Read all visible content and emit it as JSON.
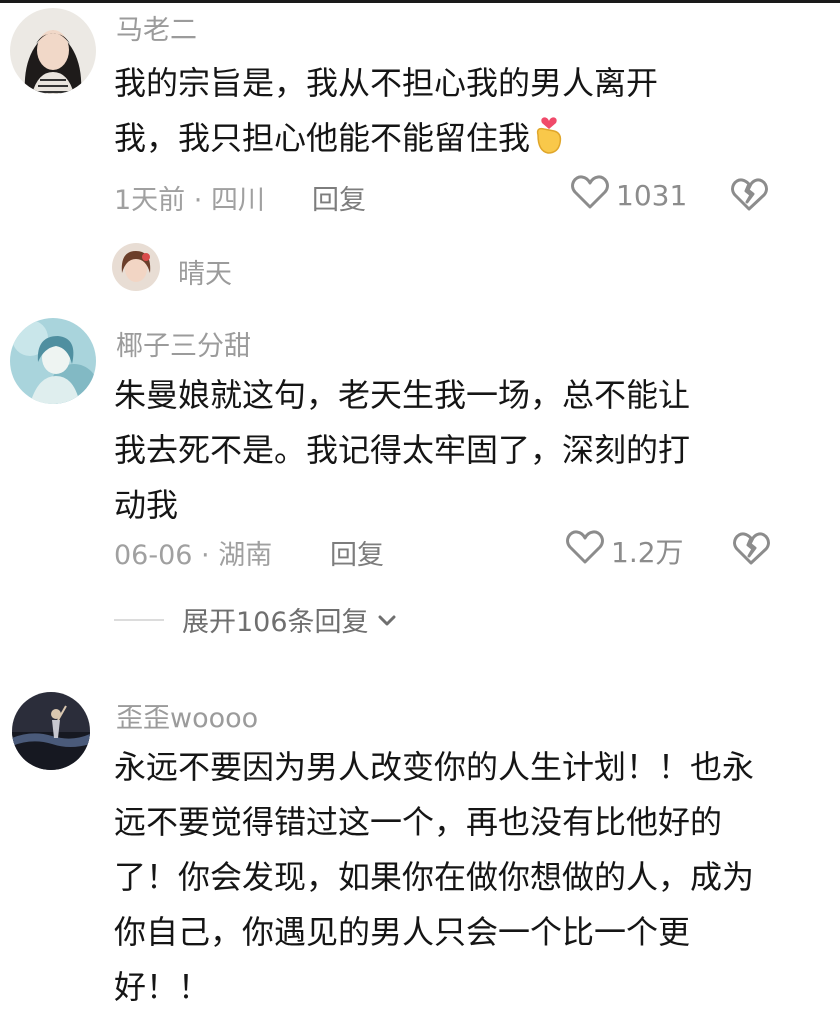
{
  "comments": [
    {
      "username": "马老二",
      "lines": [
        "我的宗旨是，我从不担心我的男人离开",
        "我，我只担心他能不能留住我"
      ],
      "emoji": "finger-heart-emoji",
      "date": "1天前",
      "location": "四川",
      "reply_label": "回复",
      "likes": "1031"
    },
    {
      "username": "椰子三分甜",
      "lines": [
        "朱曼娘就这句，老天生我一场，总不能让",
        "我去死不是。我记得太牢固了，深刻的打",
        "动我"
      ],
      "date": "06-06",
      "location": "湖南",
      "reply_label": "回复",
      "likes": "1.2万",
      "expand_label": "展开106条回复"
    },
    {
      "username": "歪歪woooo",
      "lines": [
        "永远不要因为男人改变你的人生计划！！也永",
        "远不要觉得错过这一个，再也没有比他好的",
        "了！你会发现，如果你在做你想做的人，成为",
        "你自己，你遇见的男人只会一个比一个更",
        "好！！"
      ]
    }
  ],
  "reply_thread": {
    "username": "晴天"
  },
  "icons": {
    "like": "heart-outline-icon",
    "dislike": "broken-heart-icon",
    "expand": "chevron-down-icon"
  },
  "colors": {
    "text": "#151515",
    "meta": "#a0a0a0",
    "name": "#9b9b9b"
  }
}
